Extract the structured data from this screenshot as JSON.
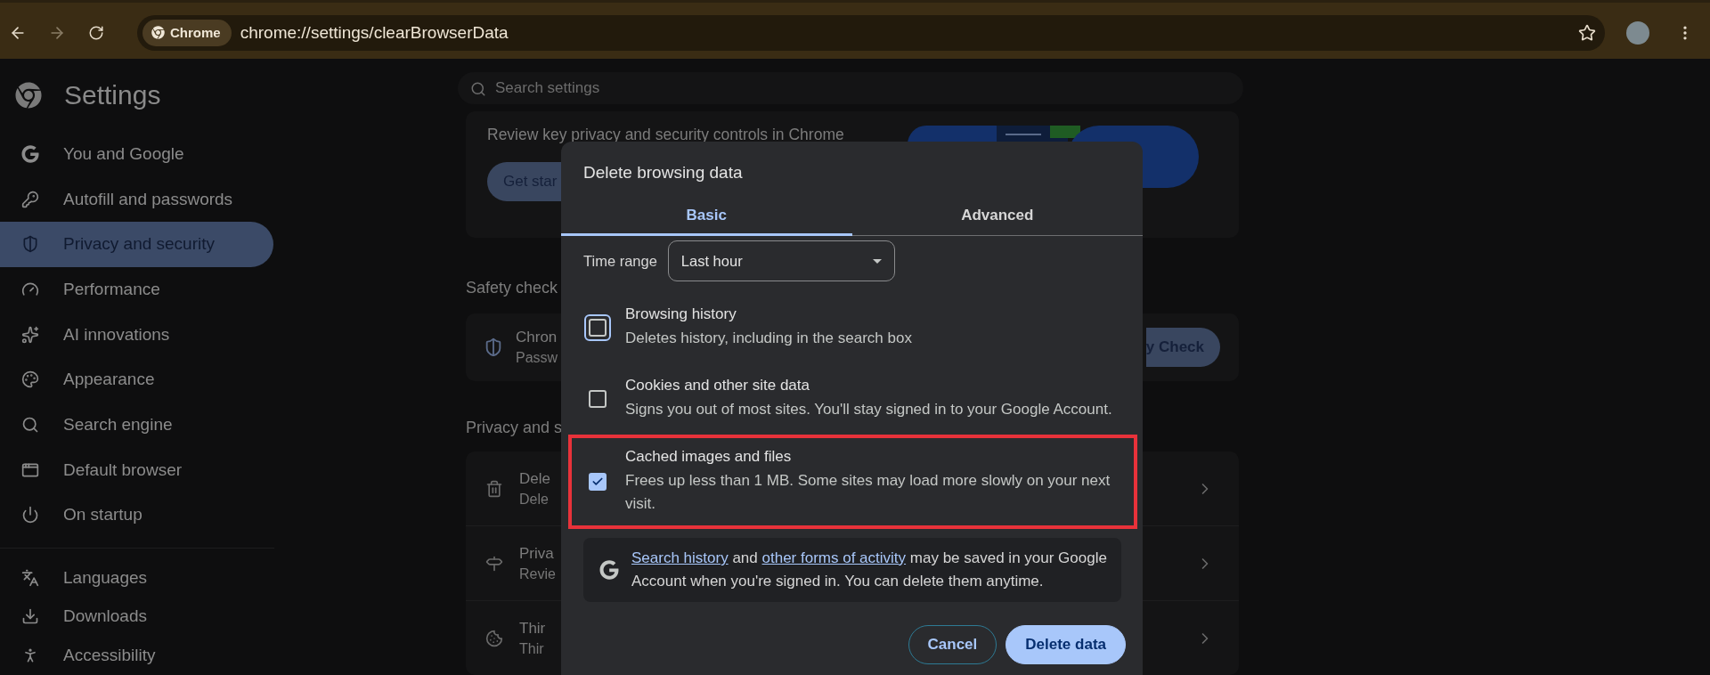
{
  "toolbar": {
    "chip": "Chrome",
    "url": "chrome://settings/clearBrowserData"
  },
  "sidebar": {
    "title": "Settings",
    "items": [
      {
        "label": "You and Google",
        "selected": false
      },
      {
        "label": "Autofill and passwords",
        "selected": false
      },
      {
        "label": "Privacy and security",
        "selected": true
      },
      {
        "label": "Performance",
        "selected": false
      },
      {
        "label": "AI innovations",
        "selected": false
      },
      {
        "label": "Appearance",
        "selected": false
      },
      {
        "label": "Search engine",
        "selected": false
      },
      {
        "label": "Default browser",
        "selected": false
      },
      {
        "label": "On startup",
        "selected": false
      }
    ],
    "more_items": [
      {
        "label": "Languages",
        "selected": false
      },
      {
        "label": "Downloads",
        "selected": false
      },
      {
        "label": "Accessibility",
        "selected": false
      }
    ]
  },
  "search": {
    "placeholder": "Search settings"
  },
  "privacy_guide_card": {
    "text": "Review key privacy and security controls in Chrome",
    "button": "Get star"
  },
  "safety_check": {
    "heading": "Safety check",
    "title": "Chron",
    "subtitle": "Passw",
    "button": "y Check"
  },
  "privacy_section": {
    "heading": "Privacy and s",
    "rows": [
      {
        "title": "Dele",
        "subtitle": "Dele"
      },
      {
        "title": "Priva",
        "subtitle": "Revie"
      },
      {
        "title": "Thir",
        "subtitle": "Thir"
      }
    ]
  },
  "dialog": {
    "title": "Delete browsing data",
    "tabs": [
      {
        "label": "Basic",
        "selected": true
      },
      {
        "label": "Advanced",
        "selected": false
      }
    ],
    "time_range": {
      "label": "Time range",
      "value": "Last hour"
    },
    "options": [
      {
        "title": "Browsing history",
        "description": "Deletes history, including in the search box",
        "checked": false,
        "focused": true,
        "highlighted": false
      },
      {
        "title": "Cookies and other site data",
        "description": "Signs you out of most sites. You'll stay signed in to your Google Account.",
        "checked": false,
        "focused": false,
        "highlighted": false
      },
      {
        "title": "Cached images and files",
        "description": "Frees up less than 1 MB. Some sites may load more slowly on your next visit.",
        "checked": true,
        "focused": false,
        "highlighted": true
      }
    ],
    "notice": [
      {
        "kind": "link",
        "text": "Search history"
      },
      {
        "kind": "text",
        "text": "and"
      },
      {
        "kind": "link",
        "text": "other forms of activity"
      },
      {
        "kind": "text",
        "text": "may be saved in your Google Account when you're signed in. You can delete them anytime."
      }
    ],
    "buttons": [
      {
        "label": "Cancel",
        "kind": "outline"
      },
      {
        "label": "Delete data",
        "kind": "filled"
      }
    ]
  }
}
